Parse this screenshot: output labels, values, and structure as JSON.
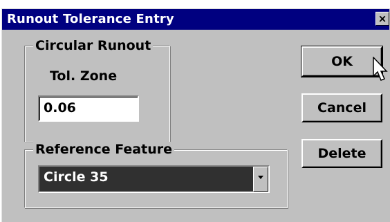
{
  "window": {
    "title": "Runout Tolerance Entry",
    "close_glyph": "×"
  },
  "circular_runout": {
    "legend": "Circular Runout",
    "tol_zone_label": "Tol. Zone",
    "tol_zone_value": "0.06"
  },
  "reference_feature": {
    "legend": "Reference Feature",
    "selected": "Circle 35"
  },
  "buttons": {
    "ok": "OK",
    "cancel": "Cancel",
    "delete": "Delete"
  },
  "colors": {
    "titlebar": "#000080",
    "face": "#c0c0c0",
    "selection": "#303030"
  },
  "icons": {
    "cursor": "arrow-pointer-icon",
    "close": "close-icon",
    "dropdown": "chevron-down-icon"
  }
}
